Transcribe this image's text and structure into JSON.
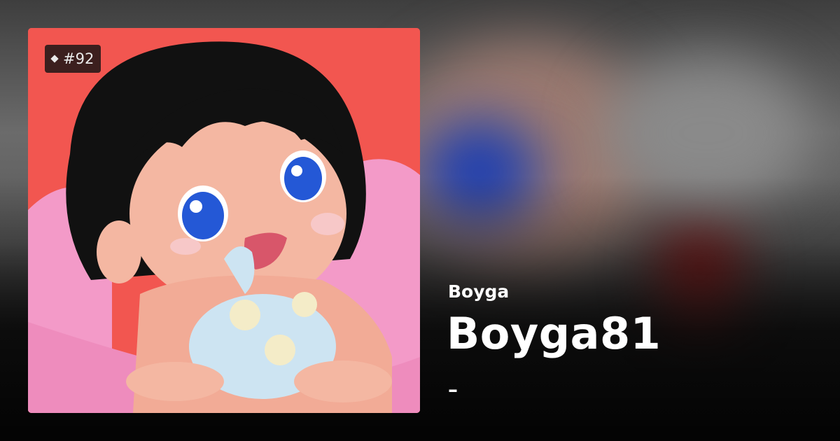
{
  "cover": {
    "rank_badge": "#92",
    "rank_icon": "diamond-icon",
    "art_description_colors": {
      "background": "#f25650",
      "hair": "#111111",
      "skin": "#f4b7a2",
      "eyes": "#2458d6",
      "blanket": "#f39ac8",
      "bottle": "#cde4f2"
    }
  },
  "release": {
    "artist": "Boyga",
    "title": "Boyga81",
    "subtitle": "–"
  }
}
